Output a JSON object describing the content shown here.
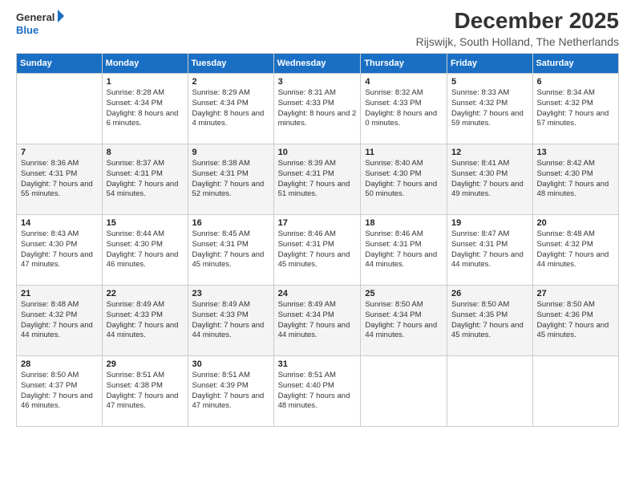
{
  "logo": {
    "line1": "General",
    "line2": "Blue"
  },
  "title": "December 2025",
  "subtitle": "Rijswijk, South Holland, The Netherlands",
  "days": [
    "Sunday",
    "Monday",
    "Tuesday",
    "Wednesday",
    "Thursday",
    "Friday",
    "Saturday"
  ],
  "weeks": [
    [
      {
        "date": "",
        "sunrise": "",
        "sunset": "",
        "daylight": ""
      },
      {
        "date": "1",
        "sunrise": "Sunrise: 8:28 AM",
        "sunset": "Sunset: 4:34 PM",
        "daylight": "Daylight: 8 hours and 6 minutes."
      },
      {
        "date": "2",
        "sunrise": "Sunrise: 8:29 AM",
        "sunset": "Sunset: 4:34 PM",
        "daylight": "Daylight: 8 hours and 4 minutes."
      },
      {
        "date": "3",
        "sunrise": "Sunrise: 8:31 AM",
        "sunset": "Sunset: 4:33 PM",
        "daylight": "Daylight: 8 hours and 2 minutes."
      },
      {
        "date": "4",
        "sunrise": "Sunrise: 8:32 AM",
        "sunset": "Sunset: 4:33 PM",
        "daylight": "Daylight: 8 hours and 0 minutes."
      },
      {
        "date": "5",
        "sunrise": "Sunrise: 8:33 AM",
        "sunset": "Sunset: 4:32 PM",
        "daylight": "Daylight: 7 hours and 59 minutes."
      },
      {
        "date": "6",
        "sunrise": "Sunrise: 8:34 AM",
        "sunset": "Sunset: 4:32 PM",
        "daylight": "Daylight: 7 hours and 57 minutes."
      }
    ],
    [
      {
        "date": "7",
        "sunrise": "Sunrise: 8:36 AM",
        "sunset": "Sunset: 4:31 PM",
        "daylight": "Daylight: 7 hours and 55 minutes."
      },
      {
        "date": "8",
        "sunrise": "Sunrise: 8:37 AM",
        "sunset": "Sunset: 4:31 PM",
        "daylight": "Daylight: 7 hours and 54 minutes."
      },
      {
        "date": "9",
        "sunrise": "Sunrise: 8:38 AM",
        "sunset": "Sunset: 4:31 PM",
        "daylight": "Daylight: 7 hours and 52 minutes."
      },
      {
        "date": "10",
        "sunrise": "Sunrise: 8:39 AM",
        "sunset": "Sunset: 4:31 PM",
        "daylight": "Daylight: 7 hours and 51 minutes."
      },
      {
        "date": "11",
        "sunrise": "Sunrise: 8:40 AM",
        "sunset": "Sunset: 4:30 PM",
        "daylight": "Daylight: 7 hours and 50 minutes."
      },
      {
        "date": "12",
        "sunrise": "Sunrise: 8:41 AM",
        "sunset": "Sunset: 4:30 PM",
        "daylight": "Daylight: 7 hours and 49 minutes."
      },
      {
        "date": "13",
        "sunrise": "Sunrise: 8:42 AM",
        "sunset": "Sunset: 4:30 PM",
        "daylight": "Daylight: 7 hours and 48 minutes."
      }
    ],
    [
      {
        "date": "14",
        "sunrise": "Sunrise: 8:43 AM",
        "sunset": "Sunset: 4:30 PM",
        "daylight": "Daylight: 7 hours and 47 minutes."
      },
      {
        "date": "15",
        "sunrise": "Sunrise: 8:44 AM",
        "sunset": "Sunset: 4:30 PM",
        "daylight": "Daylight: 7 hours and 46 minutes."
      },
      {
        "date": "16",
        "sunrise": "Sunrise: 8:45 AM",
        "sunset": "Sunset: 4:31 PM",
        "daylight": "Daylight: 7 hours and 45 minutes."
      },
      {
        "date": "17",
        "sunrise": "Sunrise: 8:46 AM",
        "sunset": "Sunset: 4:31 PM",
        "daylight": "Daylight: 7 hours and 45 minutes."
      },
      {
        "date": "18",
        "sunrise": "Sunrise: 8:46 AM",
        "sunset": "Sunset: 4:31 PM",
        "daylight": "Daylight: 7 hours and 44 minutes."
      },
      {
        "date": "19",
        "sunrise": "Sunrise: 8:47 AM",
        "sunset": "Sunset: 4:31 PM",
        "daylight": "Daylight: 7 hours and 44 minutes."
      },
      {
        "date": "20",
        "sunrise": "Sunrise: 8:48 AM",
        "sunset": "Sunset: 4:32 PM",
        "daylight": "Daylight: 7 hours and 44 minutes."
      }
    ],
    [
      {
        "date": "21",
        "sunrise": "Sunrise: 8:48 AM",
        "sunset": "Sunset: 4:32 PM",
        "daylight": "Daylight: 7 hours and 44 minutes."
      },
      {
        "date": "22",
        "sunrise": "Sunrise: 8:49 AM",
        "sunset": "Sunset: 4:33 PM",
        "daylight": "Daylight: 7 hours and 44 minutes."
      },
      {
        "date": "23",
        "sunrise": "Sunrise: 8:49 AM",
        "sunset": "Sunset: 4:33 PM",
        "daylight": "Daylight: 7 hours and 44 minutes."
      },
      {
        "date": "24",
        "sunrise": "Sunrise: 8:49 AM",
        "sunset": "Sunset: 4:34 PM",
        "daylight": "Daylight: 7 hours and 44 minutes."
      },
      {
        "date": "25",
        "sunrise": "Sunrise: 8:50 AM",
        "sunset": "Sunset: 4:34 PM",
        "daylight": "Daylight: 7 hours and 44 minutes."
      },
      {
        "date": "26",
        "sunrise": "Sunrise: 8:50 AM",
        "sunset": "Sunset: 4:35 PM",
        "daylight": "Daylight: 7 hours and 45 minutes."
      },
      {
        "date": "27",
        "sunrise": "Sunrise: 8:50 AM",
        "sunset": "Sunset: 4:36 PM",
        "daylight": "Daylight: 7 hours and 45 minutes."
      }
    ],
    [
      {
        "date": "28",
        "sunrise": "Sunrise: 8:50 AM",
        "sunset": "Sunset: 4:37 PM",
        "daylight": "Daylight: 7 hours and 46 minutes."
      },
      {
        "date": "29",
        "sunrise": "Sunrise: 8:51 AM",
        "sunset": "Sunset: 4:38 PM",
        "daylight": "Daylight: 7 hours and 47 minutes."
      },
      {
        "date": "30",
        "sunrise": "Sunrise: 8:51 AM",
        "sunset": "Sunset: 4:39 PM",
        "daylight": "Daylight: 7 hours and 47 minutes."
      },
      {
        "date": "31",
        "sunrise": "Sunrise: 8:51 AM",
        "sunset": "Sunset: 4:40 PM",
        "daylight": "Daylight: 7 hours and 48 minutes."
      },
      {
        "date": "",
        "sunrise": "",
        "sunset": "",
        "daylight": ""
      },
      {
        "date": "",
        "sunrise": "",
        "sunset": "",
        "daylight": ""
      },
      {
        "date": "",
        "sunrise": "",
        "sunset": "",
        "daylight": ""
      }
    ]
  ]
}
